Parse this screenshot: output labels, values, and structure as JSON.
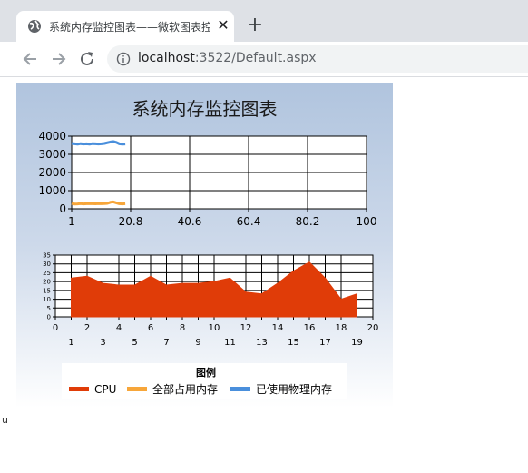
{
  "browser": {
    "tab_title": "系统内存监控图表——微软图表控件",
    "new_tab": "+",
    "close": "✕",
    "url_host": "localhost",
    "url_rest": ":3522/Default.aspx"
  },
  "page": {
    "stray_text": "u"
  },
  "chart_data": [
    {
      "type": "line",
      "title": "系统内存监控图表",
      "xlabel": "",
      "ylabel": "",
      "xlim": [
        1,
        100
      ],
      "ylim": [
        0,
        4000
      ],
      "x_ticks": [
        "1",
        "20.8",
        "40.6",
        "60.4",
        "80.2",
        "100"
      ],
      "y_ticks": [
        "0",
        "1000",
        "2000",
        "3000",
        "4000"
      ],
      "x": [
        1,
        2,
        3,
        4,
        5,
        6,
        7,
        8,
        9,
        10,
        11,
        12,
        13,
        14,
        15,
        16,
        17,
        18,
        19
      ],
      "series": [
        {
          "name": "全部占用内存",
          "color": "#f7a63a",
          "values": [
            300,
            260,
            270,
            290,
            270,
            280,
            290,
            280,
            275,
            285,
            280,
            290,
            300,
            360,
            380,
            330,
            280,
            270,
            280
          ]
        },
        {
          "name": "已使用物理内存",
          "color": "#4a8fdc",
          "values": [
            3600,
            3580,
            3560,
            3590,
            3570,
            3580,
            3560,
            3590,
            3580,
            3570,
            3580,
            3600,
            3640,
            3680,
            3700,
            3660,
            3580,
            3560,
            3570
          ]
        }
      ]
    },
    {
      "type": "area",
      "xlabel": "",
      "ylabel": "",
      "xlim": [
        0,
        20
      ],
      "ylim": [
        0,
        35
      ],
      "x_ticks_top": [
        "0",
        "2",
        "4",
        "6",
        "8",
        "10",
        "12",
        "14",
        "16",
        "18",
        "20"
      ],
      "x_ticks_bottom": [
        "1",
        "3",
        "5",
        "7",
        "9",
        "11",
        "13",
        "15",
        "17",
        "19"
      ],
      "y_ticks": [
        "0",
        "5",
        "10",
        "15",
        "20",
        "25",
        "30",
        "35"
      ],
      "x": [
        1,
        2,
        3,
        4,
        5,
        6,
        7,
        8,
        9,
        10,
        11,
        12,
        13,
        14,
        15,
        16,
        17,
        18,
        19
      ],
      "series": [
        {
          "name": "CPU",
          "color": "#e03c08",
          "values": [
            22,
            23,
            19,
            18,
            18,
            23,
            18,
            19,
            19,
            20,
            22,
            14,
            13,
            19,
            26,
            31,
            22,
            10,
            13
          ]
        }
      ]
    }
  ],
  "legend": {
    "title": "图例",
    "items": [
      {
        "label": "CPU",
        "color": "#e03c08"
      },
      {
        "label": "全部占用内存",
        "color": "#f7a63a"
      },
      {
        "label": "已使用物理内存",
        "color": "#4a8fdc"
      }
    ]
  }
}
